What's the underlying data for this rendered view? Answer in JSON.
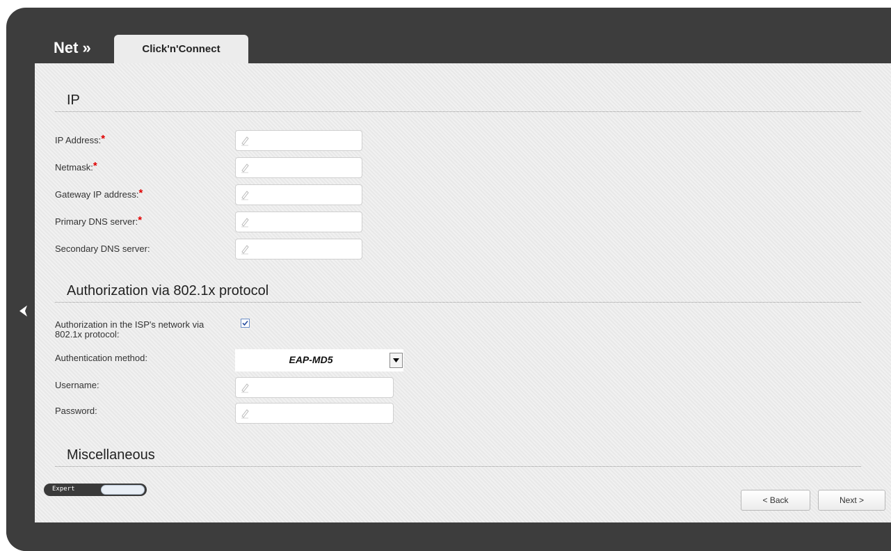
{
  "header": {
    "breadcrumb": "Net »",
    "tab_label": "Click'n'Connect"
  },
  "sections": {
    "ip": "IP",
    "auth": "Authorization via 802.1x protocol",
    "misc": "Miscellaneous"
  },
  "fields": {
    "ip_address": {
      "label": "IP Address:",
      "value": "",
      "required": true
    },
    "netmask": {
      "label": "Netmask:",
      "value": "",
      "required": true
    },
    "gateway": {
      "label": "Gateway IP address:",
      "value": "",
      "required": true
    },
    "primary_dns": {
      "label": "Primary DNS server:",
      "value": "",
      "required": true
    },
    "secondary_dns": {
      "label": "Secondary DNS server:",
      "value": "",
      "required": false
    },
    "auth_checkbox": {
      "label_line1": "Authorization in the ISP's network via",
      "label_line2": "802.1x protocol:",
      "checked": true
    },
    "auth_method": {
      "label": "Authentication method:",
      "value": "EAP-MD5"
    },
    "username": {
      "label": "Username:",
      "value": ""
    },
    "password": {
      "label": "Password:",
      "value": ""
    }
  },
  "required_marker": "*",
  "footer": {
    "expert_label": "Expert",
    "back_label": "< Back",
    "next_label": "Next >"
  },
  "icons": {
    "back_nav": "chevron-left-icon",
    "field": "pencil-icon",
    "select": "dropdown-arrow-icon"
  },
  "colors": {
    "frame": "#3d3d3d",
    "panel": "#ececec",
    "required": "#e00000"
  }
}
